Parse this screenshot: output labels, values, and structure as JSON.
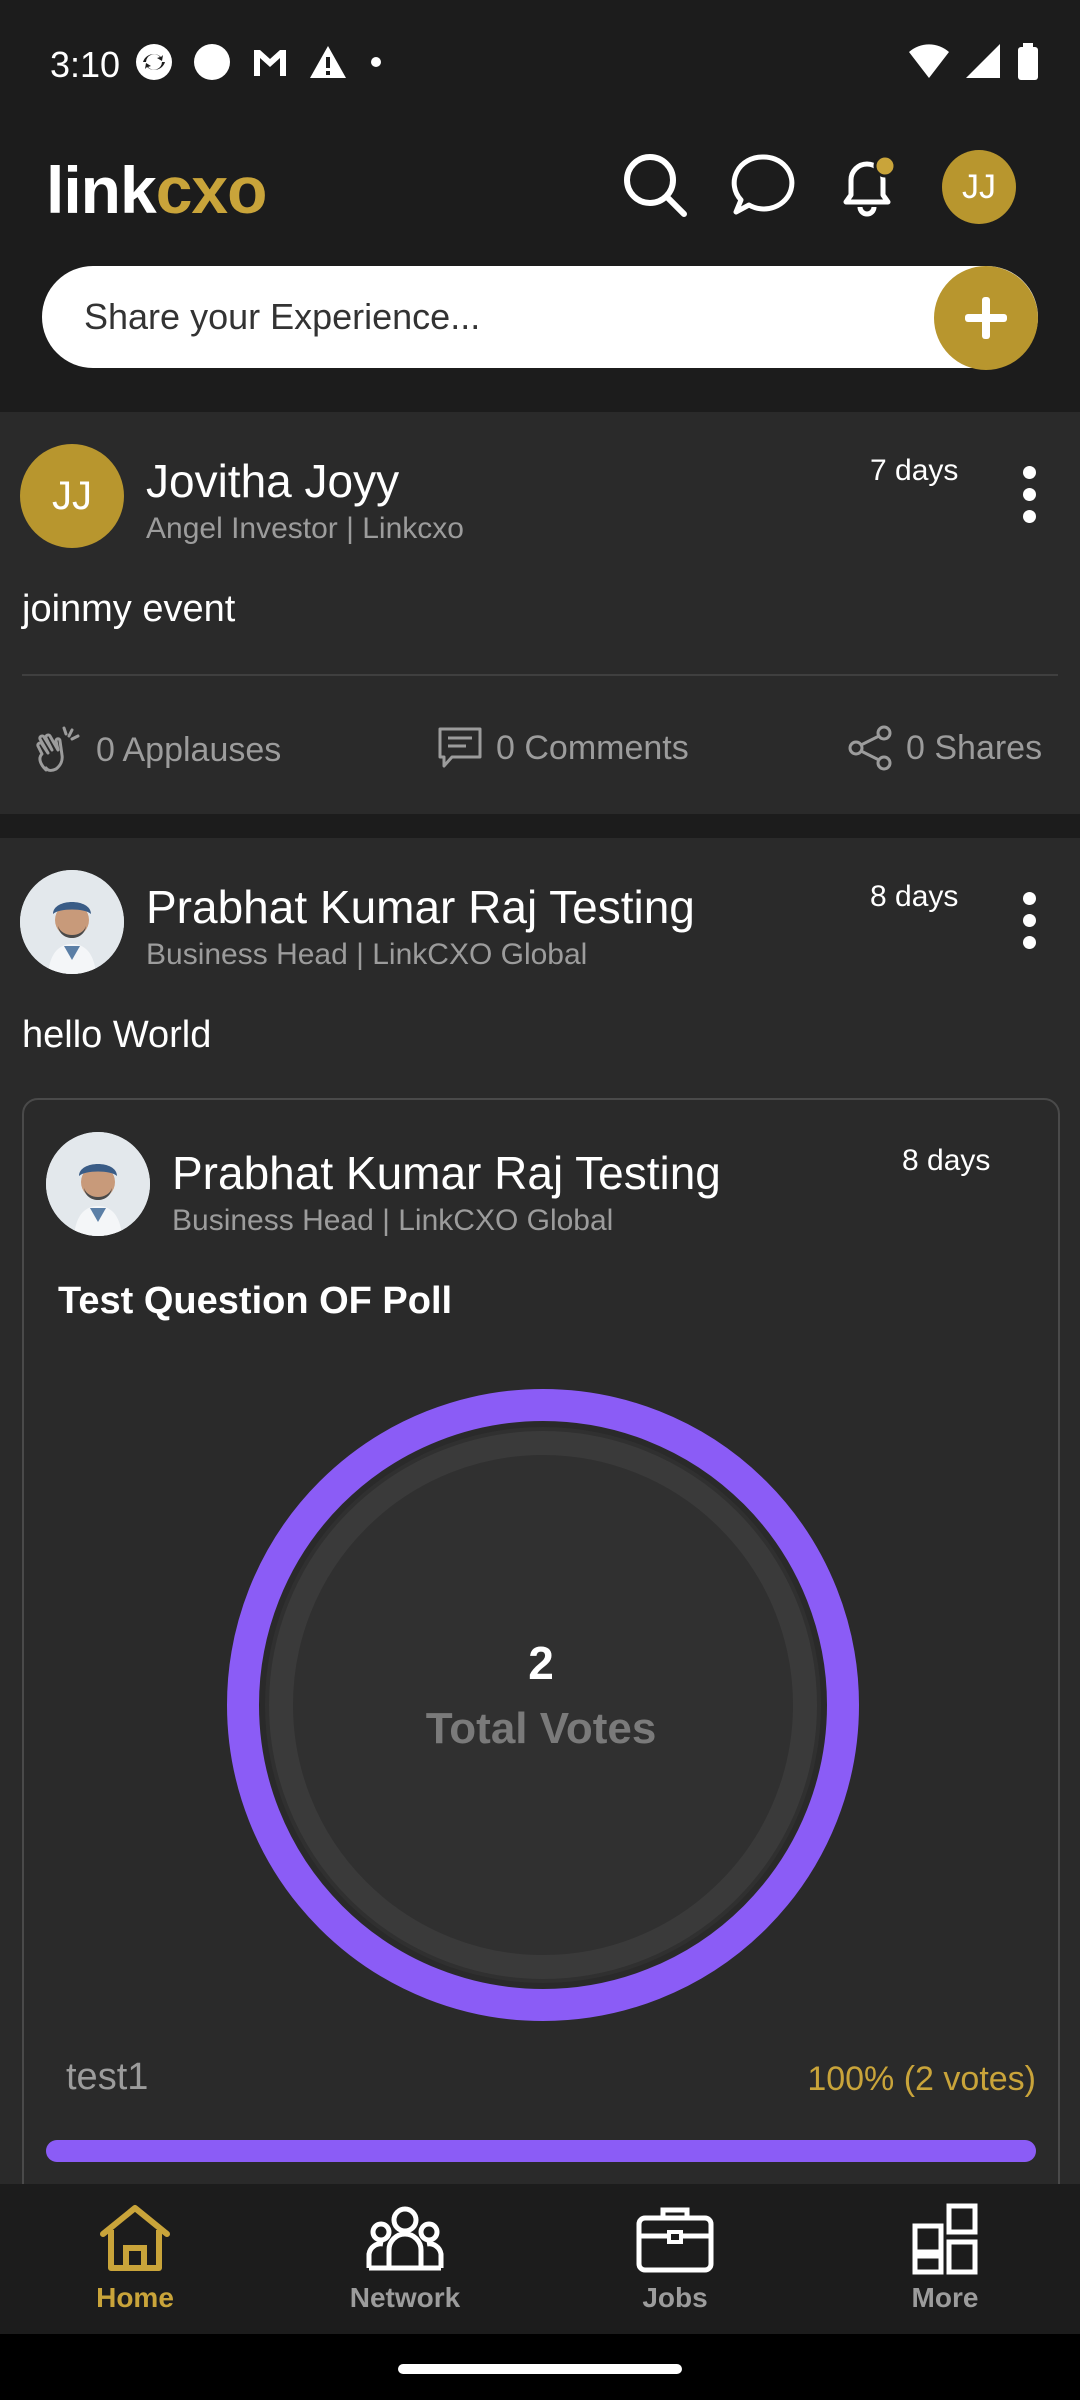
{
  "status_bar": {
    "time": "3:10",
    "left_icons": [
      "sync-icon",
      "circle-icon",
      "gmail-icon",
      "warning-icon",
      "dot-icon"
    ],
    "right_icons": [
      "wifi-icon",
      "signal-icon",
      "battery-icon"
    ]
  },
  "header": {
    "logo_part1": "link",
    "logo_part2": "cxo",
    "avatar_initials": "JJ",
    "icons": [
      "search-icon",
      "chat-icon",
      "bell-icon"
    ]
  },
  "share": {
    "placeholder": "Share your Experience..."
  },
  "posts": [
    {
      "author": "Jovitha Joyy",
      "initials": "JJ",
      "subtitle": "Angel Investor | Linkcxo",
      "time": "7 days",
      "text": "joinmy event",
      "applauses": "0 Applauses",
      "comments": "0 Comments",
      "shares": "0 Shares"
    },
    {
      "author": "Prabhat Kumar Raj Testing",
      "subtitle": "Business Head | LinkCXO Global",
      "time": "8 days",
      "text": "hello World",
      "poll": {
        "author": "Prabhat Kumar Raj Testing",
        "subtitle": "Business Head | LinkCXO Global",
        "time": "8 days",
        "question": "Test Question OF Poll",
        "total_votes": "2",
        "total_votes_label": "Total Votes",
        "accent_color": "#8b5cf6",
        "options": [
          {
            "label": "test1",
            "result": "100% (2 votes)",
            "fraction": 1.0
          }
        ]
      }
    }
  ],
  "bottom_nav": [
    {
      "label": "Home",
      "icon": "home-icon",
      "active": true
    },
    {
      "label": "Network",
      "icon": "network-icon",
      "active": false
    },
    {
      "label": "Jobs",
      "icon": "briefcase-icon",
      "active": false
    },
    {
      "label": "More",
      "icon": "grid-icon",
      "active": false
    }
  ],
  "colors": {
    "brand_gold": "#b8962e",
    "background": "#1c1c1c",
    "card": "#2a2a2a",
    "poll_purple": "#8b5cf6"
  }
}
